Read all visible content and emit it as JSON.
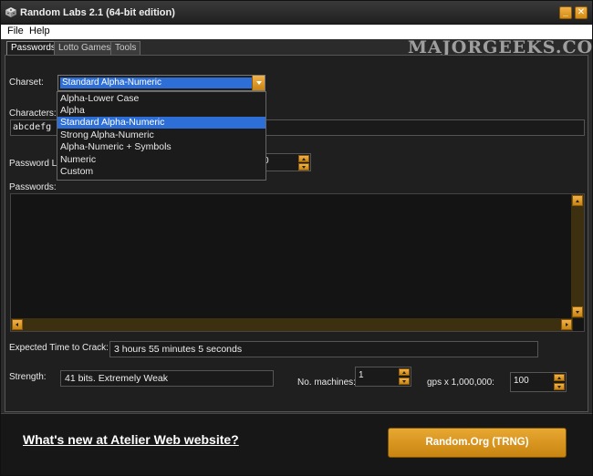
{
  "window": {
    "title": "Random Labs 2.1 (64-bit edition)",
    "min_glyph": "_",
    "close_glyph": "✕"
  },
  "menubar": {
    "items": [
      "File",
      "Help"
    ]
  },
  "watermark": "MAJORGEEKS.COM",
  "tabs": [
    {
      "label": "Passwords",
      "active": true
    },
    {
      "label": "Lotto Games",
      "active": false
    },
    {
      "label": "Tools",
      "active": false
    }
  ],
  "charset": {
    "label": "Charset:",
    "selected": "Standard Alpha-Numeric",
    "options": [
      "Alpha-Lower Case",
      "Alpha",
      "Standard Alpha-Numeric",
      "Strong Alpha-Numeric",
      "Alpha-Numeric + Symbols",
      "Numeric",
      "Custom"
    ]
  },
  "characters": {
    "label": "Characters:",
    "value": "abcdefg"
  },
  "password_length": {
    "label": "Password Length:",
    "value": "0"
  },
  "passwords": {
    "label": "Passwords:"
  },
  "crack": {
    "label": "Expected Time to Crack:",
    "value": "3 hours 55 minutes 5 seconds"
  },
  "strength": {
    "label": "Strength:",
    "value": "41 bits. Extremely Weak"
  },
  "machines": {
    "label": "No. machines:",
    "value": "1"
  },
  "gps": {
    "label": "gps x 1,000,000:",
    "value": "100"
  },
  "footer": {
    "link": "What's new at Atelier Web website?",
    "button": "Random.Org (TRNG)"
  },
  "colors": {
    "accent": "#d99a20",
    "highlight": "#2d6fd6",
    "background": "#1f1f1f"
  }
}
